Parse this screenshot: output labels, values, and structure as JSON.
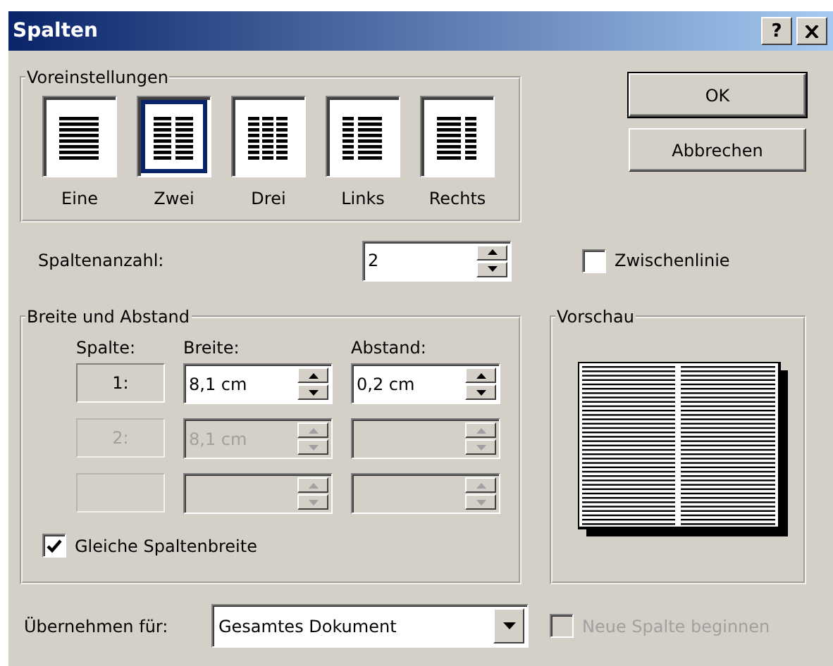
{
  "window": {
    "title": "Spalten",
    "help": "?"
  },
  "presets": {
    "title": "Voreinstellungen",
    "items": [
      {
        "label": "Eine",
        "kind": "one",
        "selected": false
      },
      {
        "label": "Zwei",
        "kind": "two",
        "selected": true
      },
      {
        "label": "Drei",
        "kind": "three",
        "selected": false
      },
      {
        "label": "Links",
        "kind": "left",
        "selected": false
      },
      {
        "label": "Rechts",
        "kind": "right",
        "selected": false
      }
    ]
  },
  "buttons": [
    "OK",
    "Abbrechen"
  ],
  "column_count": {
    "label": "Spaltenanzahl:",
    "value": "2"
  },
  "separator_line": {
    "label": "Zwischenlinie",
    "checked": false
  },
  "width_spacing": {
    "title": "Breite und Abstand",
    "headers": [
      "Spalte:",
      "Breite:",
      "Abstand:"
    ],
    "rows": [
      {
        "number": "1:",
        "width": "8,1 cm",
        "spacing": "0,2 cm",
        "disabled": false
      },
      {
        "number": "2:",
        "width": "8,1 cm",
        "disabled": true
      },
      {
        "disabled": true
      }
    ],
    "equal_width": {
      "label": "Gleiche Spaltenbreite",
      "checked": true
    }
  },
  "preview": {
    "title": "Vorschau"
  },
  "apply_to": {
    "label": "Übernehmen für:",
    "value": "Gesamtes Dokument"
  },
  "new_column": {
    "label": "Neue Spalte beginnen",
    "checked": false,
    "disabled": true
  }
}
